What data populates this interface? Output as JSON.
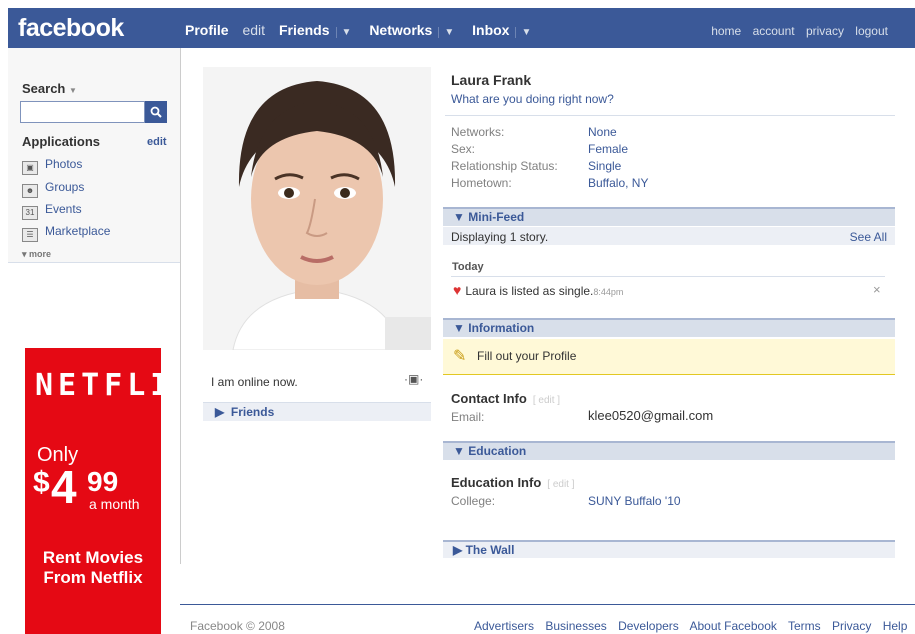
{
  "header": {
    "logo": "facebook",
    "nav": {
      "profile": "Profile",
      "edit": "edit",
      "friends": "Friends",
      "networks": "Networks",
      "inbox": "Inbox"
    },
    "links": [
      "home",
      "account",
      "privacy",
      "logout"
    ]
  },
  "sidebar": {
    "search_label": "Search",
    "applications_label": "Applications",
    "applications_edit": "edit",
    "apps": [
      {
        "label": "Photos",
        "icon": "photos-icon"
      },
      {
        "label": "Groups",
        "icon": "groups-icon"
      },
      {
        "label": "Events",
        "icon": "events-icon"
      },
      {
        "label": "Marketplace",
        "icon": "marketplace-icon"
      }
    ],
    "more": "more"
  },
  "ad": {
    "brand": "NETFLIX",
    "only": "Only",
    "price_dollar": "$",
    "price_main": "4",
    "price_cents": "99",
    "per": "a month",
    "tagline_1": "Rent Movies",
    "tagline_2": "From Netflix",
    "color": "#e50914"
  },
  "profile": {
    "name": "Laura Frank",
    "status_prompt": "What are you doing right now?",
    "online": "I am online now.",
    "friends_label": "Friends",
    "info": [
      {
        "label": "Networks:",
        "value": "None"
      },
      {
        "label": "Sex:",
        "value": "Female"
      },
      {
        "label": "Relationship Status:",
        "value": "Single"
      },
      {
        "label": "Hometown:",
        "value": "Buffalo, NY"
      }
    ]
  },
  "minifeed": {
    "title": "Mini-Feed",
    "displaying": "Displaying 1 story.",
    "see_all": "See All",
    "today": "Today",
    "story": "Laura is listed as single.",
    "story_time": "8:44pm"
  },
  "information": {
    "title": "Information",
    "fill_out": "Fill out your Profile",
    "contact_title": "Contact Info",
    "contact_edit": "[ edit ]",
    "email_label": "Email:",
    "email_value": "klee0520@gmail.com"
  },
  "education": {
    "title": "Education",
    "edu_title": "Education Info",
    "edu_edit": "[ edit ]",
    "college_label": "College:",
    "college_value": "SUNY Buffalo '10"
  },
  "wall": {
    "title": "The Wall"
  },
  "footer": {
    "copyright": "Facebook © 2008",
    "links": [
      "Advertisers",
      "Businesses",
      "Developers",
      "About Facebook",
      "Terms",
      "Privacy",
      "Help"
    ]
  },
  "colors": {
    "brand": "#3b5998",
    "section": "#d8dfea"
  }
}
